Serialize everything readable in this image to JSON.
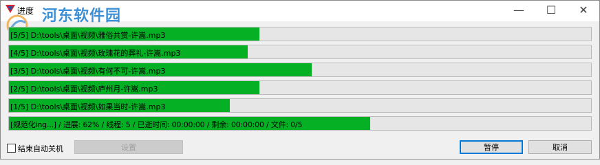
{
  "window": {
    "title": "进度",
    "watermark": "河东软件园",
    "controls": {
      "minimize": "—",
      "maximize": "☐",
      "close": "✕"
    }
  },
  "rows": [
    {
      "label": "[5/5] D:\\tools\\桌面\\视频\\雅俗共赏-许嵩.mp3",
      "progress": 0.43
    },
    {
      "label": "[4/5] D:\\tools\\桌面\\视频\\玫瑰花的葬礼-许嵩.mp3",
      "progress": 0.41
    },
    {
      "label": "[3/5] D:\\tools\\桌面\\视频\\有何不可-许嵩.mp3",
      "progress": 0.52
    },
    {
      "label": "[2/5] D:\\tools\\桌面\\视频\\庐州月-许嵩.mp3",
      "progress": 0.43
    },
    {
      "label": "[1/5] D:\\tools\\桌面\\视频\\如果当时-许嵩.mp3",
      "progress": 0.38
    }
  ],
  "status": {
    "label": "[规范化ing...] / 进展: 62% / 线程: 5 / 已逝时间: 00:00:00 / 剩余: 00:00:00 / 文件: 0/5",
    "progress": 0.62
  },
  "bottom": {
    "shutdown_label": "结束自动关机",
    "shutdown_checked": false,
    "settings_label": "设置",
    "pause_label": "暂停",
    "cancel_label": "取消"
  },
  "colors": {
    "progress_fill": "#06b025",
    "track": "#e6e6e6",
    "watermark": "#3d8fd6"
  }
}
